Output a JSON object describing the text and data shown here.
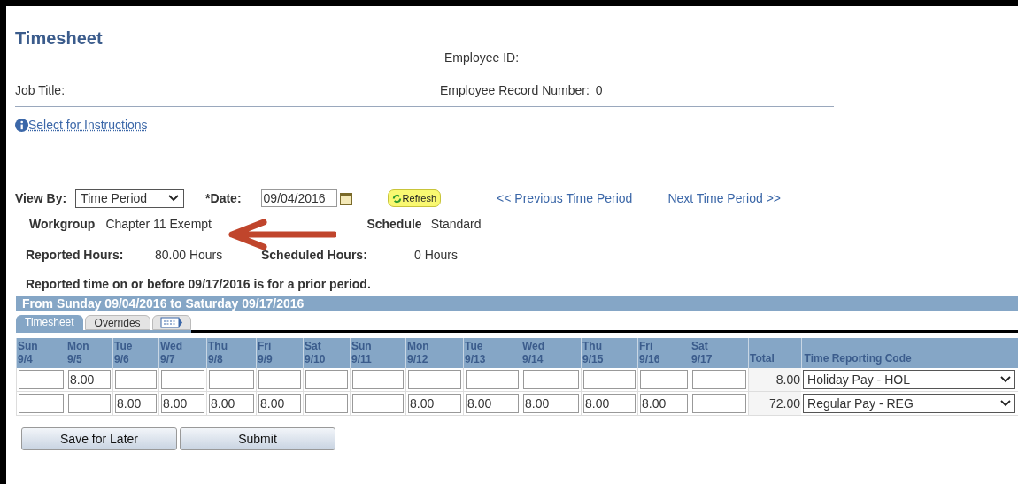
{
  "title": "Timesheet",
  "header": {
    "employee_id_label": "Employee ID:",
    "job_title_label": "Job Title:",
    "record_label": "Employee Record Number:",
    "record_value": "0"
  },
  "instructions_link": "Select for Instructions",
  "view_by": {
    "label": "View By:",
    "value": "Time Period"
  },
  "date": {
    "label": "*Date:",
    "value": "09/04/2016"
  },
  "refresh_button": "Refresh",
  "prev_link": "<< Previous Time Period",
  "next_link": "Next Time Period >>",
  "workgroup": {
    "label": "Workgroup",
    "value": "Chapter 11 Exempt"
  },
  "schedule": {
    "label": "Schedule",
    "value": "Standard"
  },
  "reported_hours": {
    "label": "Reported Hours:",
    "value": "80.00 Hours"
  },
  "scheduled_hours": {
    "label": "Scheduled Hours:",
    "value": "0 Hours"
  },
  "notice": "Reported time on or before 09/17/2016 is for a prior period.",
  "period_banner": "From Sunday 09/04/2016 to Saturday 09/17/2016",
  "tabs": [
    {
      "label": "Timesheet",
      "selected": true
    },
    {
      "label": "Overrides",
      "selected": false
    }
  ],
  "table": {
    "columns": [
      {
        "day": "Sun",
        "date": "9/4"
      },
      {
        "day": "Mon",
        "date": "9/5"
      },
      {
        "day": "Tue",
        "date": "9/6"
      },
      {
        "day": "Wed",
        "date": "9/7"
      },
      {
        "day": "Thu",
        "date": "9/8"
      },
      {
        "day": "Fri",
        "date": "9/9"
      },
      {
        "day": "Sat",
        "date": "9/10"
      },
      {
        "day": "Sun",
        "date": "9/11"
      },
      {
        "day": "Mon",
        "date": "9/12"
      },
      {
        "day": "Tue",
        "date": "9/13"
      },
      {
        "day": "Wed",
        "date": "9/14"
      },
      {
        "day": "Thu",
        "date": "9/15"
      },
      {
        "day": "Fri",
        "date": "9/16"
      },
      {
        "day": "Sat",
        "date": "9/17"
      }
    ],
    "total_header": "Total",
    "code_header": "Time Reporting Code",
    "rows": [
      {
        "cells": [
          {
            "kind": "empty"
          },
          {
            "kind": "entry",
            "value": "8.00"
          },
          {
            "kind": "empty"
          },
          {
            "kind": "empty"
          },
          {
            "kind": "empty"
          },
          {
            "kind": "empty"
          },
          {
            "kind": "empty"
          },
          {
            "kind": "empty"
          },
          {
            "kind": "empty"
          },
          {
            "kind": "empty"
          },
          {
            "kind": "empty"
          },
          {
            "kind": "empty"
          },
          {
            "kind": "empty"
          },
          {
            "kind": "empty"
          }
        ],
        "total": "8.00",
        "code": "Holiday Pay - HOL"
      },
      {
        "cells": [
          {
            "kind": "empty"
          },
          {
            "kind": "empty"
          },
          {
            "kind": "entry",
            "value": "8.00"
          },
          {
            "kind": "entry",
            "value": "8.00"
          },
          {
            "kind": "entry",
            "value": "8.00"
          },
          {
            "kind": "entry",
            "value": "8.00"
          },
          {
            "kind": "empty"
          },
          {
            "kind": "empty"
          },
          {
            "kind": "entry",
            "value": "8.00"
          },
          {
            "kind": "entry",
            "value": "8.00"
          },
          {
            "kind": "entry",
            "value": "8.00"
          },
          {
            "kind": "entry",
            "value": "8.00"
          },
          {
            "kind": "entry",
            "value": "8.00"
          },
          {
            "kind": "empty"
          }
        ],
        "total": "72.00",
        "code": "Regular Pay - REG"
      }
    ]
  },
  "buttons": [
    "Save for Later",
    "Submit"
  ]
}
